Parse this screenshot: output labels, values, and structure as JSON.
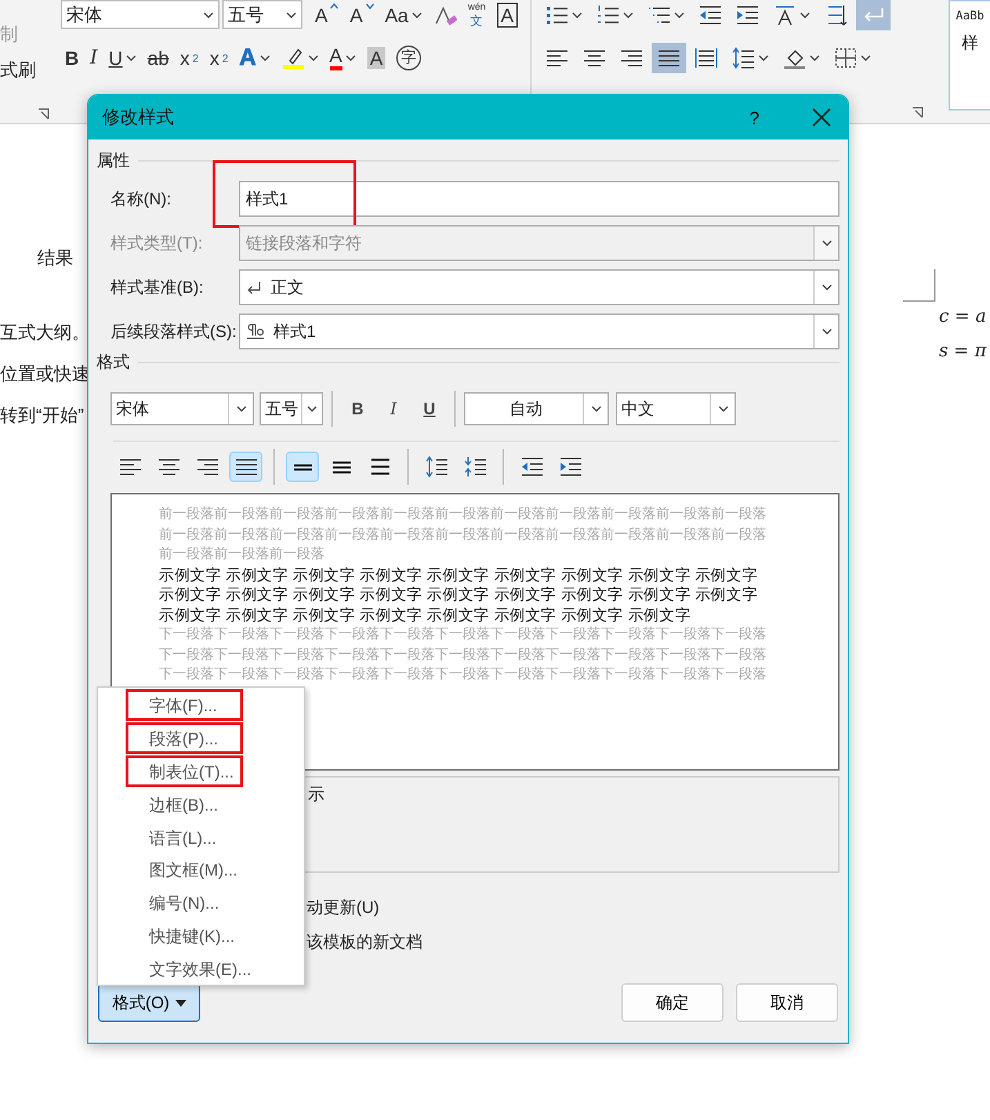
{
  "ribbon": {
    "clipboard": [
      "制",
      "式刷"
    ],
    "font_row1": [
      {
        "kind": "combo",
        "text": "宋体"
      },
      {
        "kind": "combo",
        "text": "五号"
      },
      {
        "kind": "grow",
        "text": "A"
      },
      {
        "kind": "shrink",
        "text": "A"
      },
      {
        "kind": "case",
        "text": "Aa",
        "dropdown": true
      },
      {
        "kind": "clear-format"
      },
      {
        "kind": "phonetic",
        "ruby": "wén",
        "text": "文"
      },
      {
        "kind": "boxed",
        "text": "A"
      }
    ],
    "font_row2": [
      {
        "kind": "bold",
        "text": "B"
      },
      {
        "kind": "italic",
        "text": "I"
      },
      {
        "kind": "underline",
        "text": "U",
        "dropdown": true
      },
      {
        "kind": "strike",
        "text": "ab"
      },
      {
        "kind": "sub",
        "text": "x",
        "script": "2"
      },
      {
        "kind": "sup",
        "text": "x",
        "script": "2"
      },
      {
        "kind": "effect",
        "text": "A",
        "dropdown": true
      },
      {
        "kind": "highlight",
        "dropdown": true,
        "color": "#ffff00"
      },
      {
        "kind": "font-color",
        "text": "A",
        "dropdown": true,
        "color": "#ff0000"
      },
      {
        "kind": "shade",
        "text": "A"
      },
      {
        "kind": "enclose",
        "text": "字"
      }
    ],
    "para_row1": [
      {
        "kind": "bullets",
        "dropdown": true,
        "selected": false
      },
      {
        "kind": "numbering",
        "dropdown": true,
        "selected": false
      },
      {
        "kind": "multilevel",
        "dropdown": true,
        "selected": false
      },
      {
        "kind": "outdent",
        "selected": false
      },
      {
        "kind": "indent",
        "selected": false
      },
      {
        "kind": "asian-layout",
        "dropdown": true,
        "selected": false
      },
      {
        "kind": "sort",
        "selected": false
      },
      {
        "kind": "marks",
        "selected": true
      }
    ],
    "para_row2": [
      {
        "kind": "align-left",
        "selected": false
      },
      {
        "kind": "align-center",
        "selected": false
      },
      {
        "kind": "align-right",
        "selected": false
      },
      {
        "kind": "justify",
        "selected": true
      },
      {
        "kind": "distributed",
        "selected": false
      },
      {
        "kind": "line-spacing",
        "dropdown": true,
        "selected": false
      },
      {
        "kind": "shading",
        "dropdown": true,
        "selected": false
      },
      {
        "kind": "borders",
        "dropdown": true,
        "selected": false
      }
    ],
    "gallery": {
      "sample": "AaBb",
      "label": "样"
    }
  },
  "document": {
    "left_texts": [
      "结果",
      "互式大纲。",
      "位置或快速",
      "转到“开始”"
    ],
    "formulas": [
      "c = a",
      "s = π"
    ]
  },
  "dialog": {
    "title": "修改样式",
    "help": "?",
    "properties": {
      "heading": "属性",
      "fields": [
        {
          "label": "名称(N):",
          "kind": "text",
          "value": "样式1",
          "disabled": false,
          "highlighted": true
        },
        {
          "label": "样式类型(T):",
          "kind": "combo",
          "value": "链接段落和字符",
          "disabled": true,
          "highlighted": false
        },
        {
          "label": "样式基准(B):",
          "kind": "combo-return",
          "value": "正文",
          "disabled": false,
          "highlighted": false
        },
        {
          "label": "后续段落样式(S):",
          "kind": "combo-style",
          "value": "样式1",
          "disabled": false,
          "highlighted": false
        }
      ]
    },
    "format": {
      "heading": "格式",
      "font": "宋体",
      "size": "五号",
      "styles": [
        {
          "kind": "bold",
          "text": "B"
        },
        {
          "kind": "italic",
          "text": "I"
        },
        {
          "kind": "underline",
          "text": "U"
        }
      ],
      "color_choice": "自动",
      "language": "中文",
      "paragraph": [
        {
          "kind": "align-left",
          "selected": false
        },
        {
          "kind": "align-center",
          "selected": false
        },
        {
          "kind": "align-right",
          "selected": false
        },
        {
          "kind": "justify",
          "selected": true
        },
        {
          "kind": "single",
          "selected": true
        },
        {
          "kind": "one-half",
          "selected": false
        },
        {
          "kind": "double",
          "selected": false
        },
        {
          "kind": "space-increase",
          "selected": false
        },
        {
          "kind": "space-decrease",
          "selected": false
        },
        {
          "kind": "outdent",
          "selected": false
        },
        {
          "kind": "indent",
          "selected": false
        }
      ]
    },
    "preview": {
      "previous": [
        "前一段落前一段落前一段落前一段落前一段落前一段落前一段落前一段落前一段落前一段落前一段落",
        "前一段落前一段落前一段落前一段落前一段落前一段落前一段落前一段落前一段落前一段落前一段落",
        "前一段落前一段落前一段落"
      ],
      "sample": [
        "示例文字 示例文字 示例文字 示例文字 示例文字 示例文字 示例文字 示例文字 示例文字",
        "示例文字 示例文字 示例文字 示例文字 示例文字 示例文字 示例文字 示例文字 示例文字",
        "示例文字 示例文字 示例文字 示例文字 示例文字 示例文字 示例文字 示例文字"
      ],
      "next": [
        "下一段落下一段落下一段落下一段落下一段落下一段落下一段落下一段落下一段落下一段落下一段落",
        "下一段落下一段落下一段落下一段落下一段落下一段落下一段落下一段落下一段落下一段落下一段落",
        "下一段落下一段落下一段落下一段落下一段落下一段落下一段落下一段落下一段落下一段落下一段落"
      ]
    },
    "description": "示",
    "options": [
      "动更新(U)",
      "该模板的新文档"
    ],
    "format_button": {
      "label": "格式(O)",
      "open": true
    },
    "buttons": [
      "确定",
      "取消"
    ],
    "menu": {
      "items": [
        {
          "label": "字体(F)...",
          "highlighted": true
        },
        {
          "label": "段落(P)...",
          "highlighted": true
        },
        {
          "label": "制表位(T)...",
          "highlighted": true
        },
        {
          "label": "边框(B)...",
          "highlighted": false
        },
        {
          "label": "语言(L)...",
          "highlighted": false
        },
        {
          "label": "图文框(M)...",
          "highlighted": false
        },
        {
          "label": "编号(N)...",
          "highlighted": false
        },
        {
          "label": "快捷键(K)...",
          "highlighted": false
        },
        {
          "label": "文字效果(E)...",
          "highlighted": false
        }
      ]
    }
  }
}
